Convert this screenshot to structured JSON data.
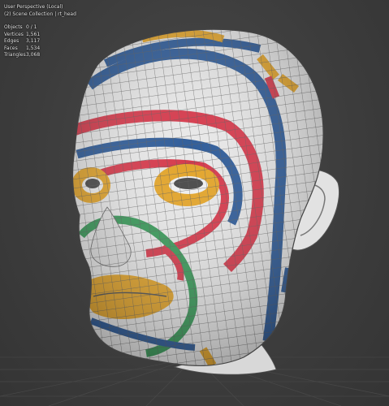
{
  "viewport": {
    "view_name": "User Perspective (Local)",
    "collection": "(2) Scene Collection | rt_head"
  },
  "stats": [
    {
      "label": "Objects",
      "value": "0 / 1"
    },
    {
      "label": "Vertices",
      "value": "1,561"
    },
    {
      "label": "Edges",
      "value": "3,117"
    },
    {
      "label": "Faces",
      "value": "1,534"
    },
    {
      "label": "Triangles",
      "value": "3,068"
    }
  ],
  "colors": {
    "background": "#3d3d3d",
    "mesh_base": "#e8e8e8",
    "wire": "#555555",
    "yellow": "#e3a52c",
    "red": "#d63a4c",
    "blue": "#2f5c99",
    "green": "#3a9a5a"
  }
}
